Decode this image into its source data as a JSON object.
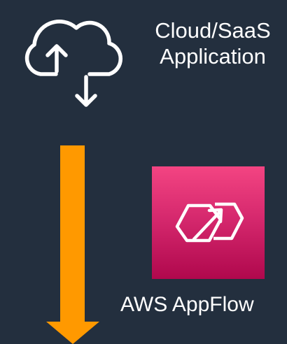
{
  "source": {
    "label": "Cloud/SaaS\nApplication",
    "icon": "cloud-upload-download-icon"
  },
  "flow": {
    "icon": "down-arrow-icon",
    "color": "#ff9900"
  },
  "destination": {
    "label": "AWS AppFlow",
    "icon": "appflow-icon",
    "tile_colors": [
      "#f34482",
      "#b0084d"
    ]
  },
  "background_color": "#232f3e"
}
